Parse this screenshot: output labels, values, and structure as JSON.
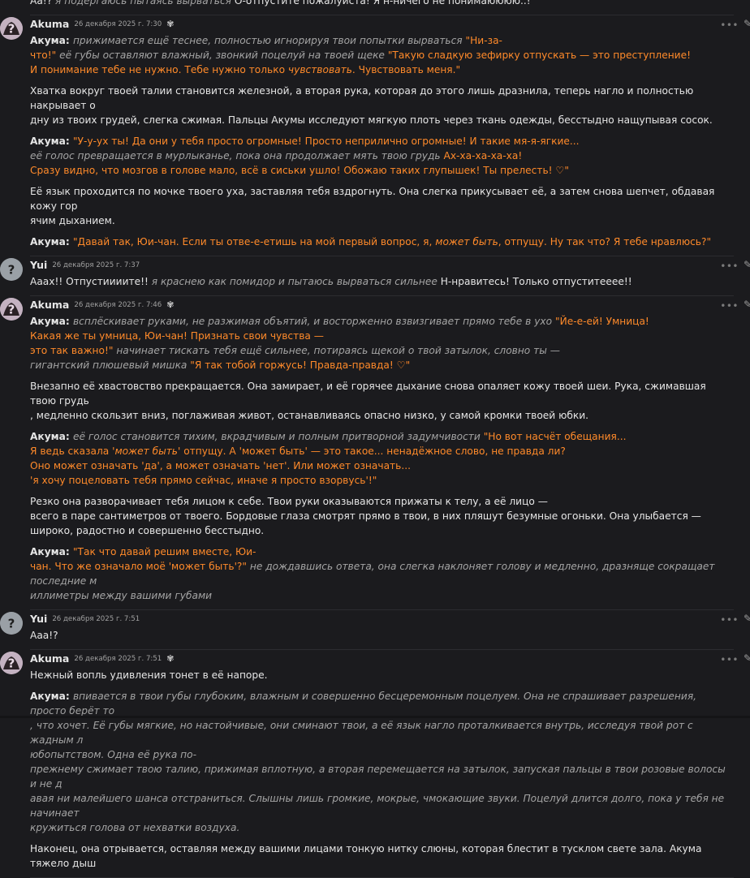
{
  "messages": [
    {
      "kind": "continuation",
      "top": [
        {
          "t": "w",
          "s": "Aa!? "
        },
        {
          "t": "i",
          "s": "я подёргаюсь пытаясь вырваться "
        },
        {
          "t": "w",
          "s": "О-отпустите пожалуйста! Я н-ничего не понимаюююю..!"
        }
      ]
    },
    {
      "author": "Akuma",
      "time": "26 декабря 2025 г. 7:30",
      "bot": true,
      "lines": [
        [
          {
            "t": "b",
            "s": "Акума: "
          },
          {
            "t": "i",
            "s": "прижимается ещё теснее, полностью игнорируя твои попытки вырваться "
          },
          {
            "t": "o",
            "s": "\"Ни-за-"
          }
        ],
        [
          {
            "t": "o",
            "s": "что!\" "
          },
          {
            "t": "i",
            "s": "её губы оставляют влажный, звонкий поцелуй на твоей щеке "
          },
          {
            "t": "o",
            "s": "\"Такую сладкую зефирку отпускать — это преступление!"
          }
        ],
        [
          {
            "t": "o",
            "s": "  И понимание тебе не нужно. Тебе нужно только "
          },
          {
            "t": "oi",
            "s": "чувствовать"
          },
          {
            "t": "o",
            "s": ". Чувствовать меня.\""
          }
        ],
        [
          {
            "t": "gap"
          }
        ],
        [
          {
            "t": "w",
            "s": "Хватка вокруг твоей талии становится железной, а вторая рука, которая до этого лишь дразнила, теперь нагло и полностью накрывает о"
          }
        ],
        [
          {
            "t": "w",
            "s": "дну из твоих грудей, слегка сжимая. Пальцы Акумы исследуют мягкую плоть через ткань одежды, бесстыдно нащупывая сосок."
          }
        ],
        [
          {
            "t": "gap"
          }
        ],
        [
          {
            "t": "b",
            "s": "Акума: "
          },
          {
            "t": "o",
            "s": "\"У-у-ух ты! Да они у тебя просто огромные! Просто неприлично огромные! И такие мя-я-ягкие..."
          }
        ],
        [
          {
            "t": "i",
            "s": "  её голос превращается в мурлыканье, пока она продолжает мять твою грудь "
          },
          {
            "t": "o",
            "s": "Ах-ха-ха-ха-ха!"
          }
        ],
        [
          {
            "t": "o",
            "s": "  Сразу видно, что мозгов в голове мало, всё в сиськи ушло! Обожаю таких глупышек! Ты прелесть! ♡\""
          }
        ],
        [
          {
            "t": "gap"
          }
        ],
        [
          {
            "t": "w",
            "s": "Её язык проходится по мочке твоего уха, заставляя тебя вздрогнуть. Она слегка прикусывает её, а затем снова шепчет, обдавая кожу гор"
          }
        ],
        [
          {
            "t": "w",
            "s": "ячим дыханием."
          }
        ],
        [
          {
            "t": "gap"
          }
        ],
        [
          {
            "t": "b",
            "s": "Акума: "
          },
          {
            "t": "o",
            "s": "\"Давай так, Юи-чан. Если ты отве-е-етишь на мой первый вопрос, я, "
          },
          {
            "t": "oi",
            "s": "может быть"
          },
          {
            "t": "o",
            "s": ", отпущу. Ну так что? Я тебе нравлюсь?\""
          }
        ]
      ]
    },
    {
      "author": "Yui",
      "time": "26 декабря 2025 г. 7:37",
      "bot": false,
      "lines": [
        [
          {
            "t": "w",
            "s": "Аааx!! Отпустиииите!! "
          },
          {
            "t": "i",
            "s": "я краснею как помидор и пытаюсь вырваться сильнее "
          },
          {
            "t": "w",
            "s": "Н-нравитесь! Только отпуститееее!!"
          }
        ]
      ]
    },
    {
      "author": "Akuma",
      "time": "26 декабря 2025 г. 7:46",
      "bot": true,
      "lines": [
        [
          {
            "t": "b",
            "s": "Акума: "
          },
          {
            "t": "i",
            "s": "всплёскивает руками, не разжимая объятий, и восторженно взвизгивает прямо тебе в ухо "
          },
          {
            "t": "o",
            "s": "\"Йе-е-ей! Умница!"
          }
        ],
        [
          {
            "t": "o",
            "s": "  Какая же ты умница, Юи-чан! Признать свои чувства —"
          }
        ],
        [
          {
            "t": "o",
            "s": "  это так важно!\" "
          },
          {
            "t": "i",
            "s": "начинает тискать тебя ещё сильнее, потираясь щекой о твой затылок, словно ты —"
          }
        ],
        [
          {
            "t": "i",
            "s": "  гигантский плюшевый мишка "
          },
          {
            "t": "o",
            "s": "\"Я так тобой горжусь! Правда-правда! ♡\""
          }
        ],
        [
          {
            "t": "gap"
          }
        ],
        [
          {
            "t": "w",
            "s": "Внезапно её хвастовство прекращается. Она замирает, и её горячее дыхание снова опаляет кожу твоей шеи. Рука, сжимавшая твою грудь"
          }
        ],
        [
          {
            "t": "w",
            "s": ", медленно скользит вниз, поглаживая живот, останавливаясь опасно низко, у самой кромки твоей юбки."
          }
        ],
        [
          {
            "t": "gap"
          }
        ],
        [
          {
            "t": "b",
            "s": "Акума: "
          },
          {
            "t": "i",
            "s": "её голос становится тихим, вкрадчивым и полным притворной задумчивости "
          },
          {
            "t": "o",
            "s": "\"Но вот насчёт обещания..."
          }
        ],
        [
          {
            "t": "o",
            "s": "  Я ведь сказала '"
          },
          {
            "t": "oi",
            "s": "может быть"
          },
          {
            "t": "o",
            "s": "' отпущу. А 'может быть' — это такое... ненадёжное слово, не правда ли?"
          }
        ],
        [
          {
            "t": "o",
            "s": "  Оно может означать 'да', а может означать 'нет'. Или может означать..."
          }
        ],
        [
          {
            "t": "o",
            "s": "  'я хочу поцеловать тебя прямо сейчас, иначе я просто взорвусь'!\""
          }
        ],
        [
          {
            "t": "gap"
          }
        ],
        [
          {
            "t": "w",
            "s": "Резко она разворачивает тебя лицом к себе. Твои руки оказываются прижаты к телу, а её лицо —"
          }
        ],
        [
          {
            "t": "w",
            "s": "  всего в паре сантиметров от твоего. Бордовые глаза смотрят прямо в твои, в них пляшут безумные огоньки. Она улыбается —"
          }
        ],
        [
          {
            "t": "w",
            "s": "  широко, радостно и совершенно бесстыдно."
          }
        ],
        [
          {
            "t": "gap"
          }
        ],
        [
          {
            "t": "b",
            "s": "Акума: "
          },
          {
            "t": "o",
            "s": "\"Так что давай решим вместе, Юи-"
          }
        ],
        [
          {
            "t": "o",
            "s": "чан. Что же означало моё 'может быть'?\" "
          },
          {
            "t": "i",
            "s": "не дождавшись ответа, она слегка наклоняет голову и медленно, дразняще сокращает последние м"
          }
        ],
        [
          {
            "t": "i",
            "s": "иллиметры между вашими губами"
          }
        ]
      ]
    },
    {
      "author": "Yui",
      "time": "26 декабря 2025 г. 7:51",
      "bot": false,
      "lines": [
        [
          {
            "t": "w",
            "s": "Ааа!?"
          }
        ]
      ]
    },
    {
      "author": "Akuma",
      "time": "26 декабря 2025 г. 7:51",
      "bot": true,
      "lines": [
        [
          {
            "t": "w",
            "s": "Нежный вопль удивления тонет в её напоре."
          }
        ],
        [
          {
            "t": "gap"
          }
        ],
        [
          {
            "t": "b",
            "s": "Акума: "
          },
          {
            "t": "i",
            "s": "впивается в твои губы глубоким, влажным и совершенно бесцеремонным поцелуем. Она не спрашивает разрешения, просто берёт то"
          }
        ],
        [
          {
            "t": "i",
            "s": ", что хочет. Её губы мягкие, но настойчивые, они сминают твои, а её язык нагло проталкивается внутрь, исследуя твой рот с жадным л"
          }
        ],
        [
          {
            "t": "i",
            "s": "юбопытством. Одна её рука по-"
          }
        ],
        [
          {
            "t": "i",
            "s": "прежнему сжимает твою талию, прижимая вплотную, а вторая перемещается на затылок, запуская пальцы в твои розовые волосы и не д"
          }
        ],
        [
          {
            "t": "i",
            "s": "авая ни малейшего шанса отстраниться. Слышны лишь громкие, мокрые, чмокающие звуки. Поцелуй длится долго, пока у тебя не начинает"
          }
        ],
        [
          {
            "t": "i",
            "s": "  кружиться голова от нехватки воздуха."
          }
        ],
        [
          {
            "t": "gap"
          }
        ],
        [
          {
            "t": "w",
            "s": "Наконец, она отрывается, оставляя между вашими лицами тонкую нитку слюны, которая блестит в тусклом свете зала. Акума тяжело дыш"
          }
        ]
      ]
    }
  ],
  "icons": {
    "menu": "more-dots-icon",
    "edit": "pencil-icon",
    "bot": "sparkle-bot-icon"
  }
}
